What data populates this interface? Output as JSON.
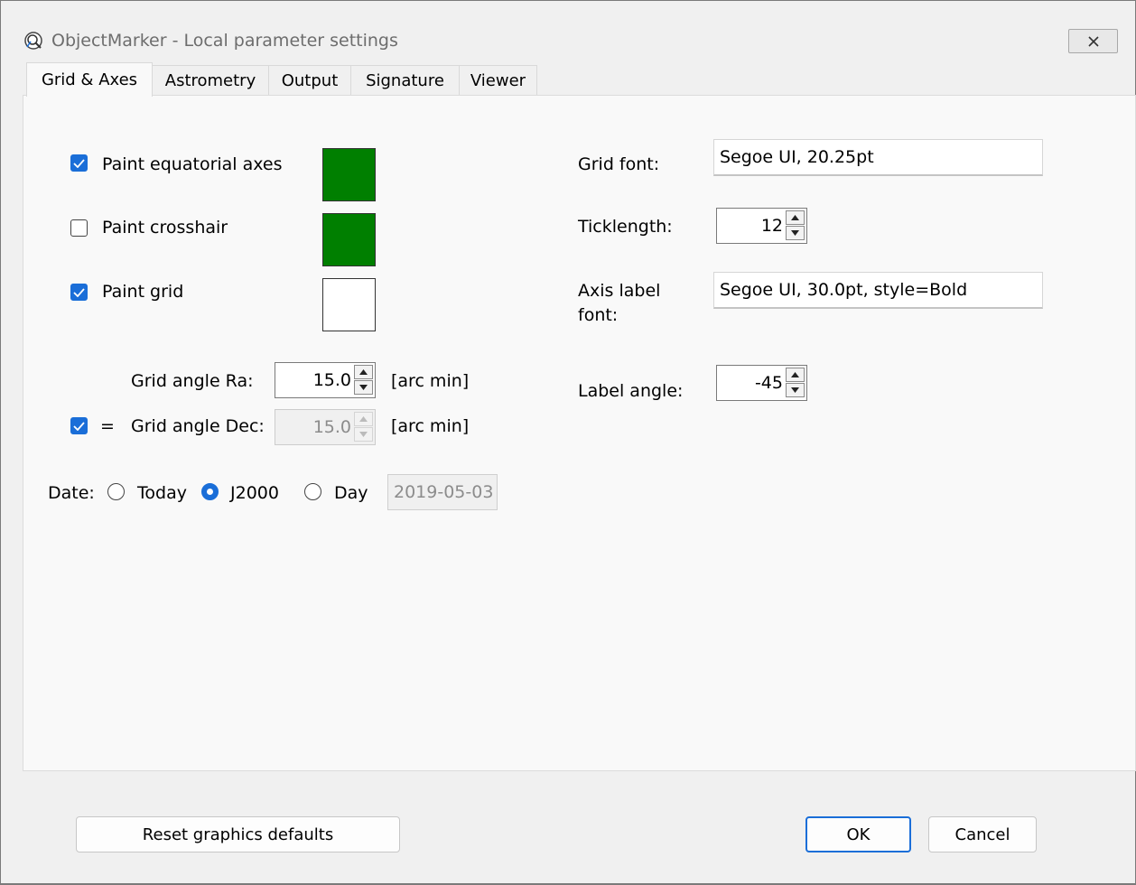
{
  "window": {
    "title": "ObjectMarker - Local parameter settings",
    "icon": "objectmarker-app-icon",
    "close_icon": "close-icon"
  },
  "tabs": [
    {
      "label": "Grid & Axes",
      "active": true
    },
    {
      "label": "Astrometry",
      "active": false
    },
    {
      "label": "Output",
      "active": false
    },
    {
      "label": "Signature",
      "active": false
    },
    {
      "label": "Viewer",
      "active": false
    }
  ],
  "left": {
    "paint_equatorial_axes": {
      "label": "Paint equatorial axes",
      "checked": true,
      "color": "#007f00"
    },
    "paint_crosshair": {
      "label": "Paint crosshair",
      "checked": false,
      "color": "#007f00"
    },
    "paint_grid": {
      "label": "Paint grid",
      "checked": true,
      "color": "#ffffff"
    },
    "grid_angle_ra": {
      "label": "Grid angle Ra:",
      "value": "15.0",
      "unit": "[arc min]"
    },
    "grid_angle_dec": {
      "equal_checked": true,
      "equal_sign": "=",
      "label": "Grid angle Dec:",
      "value": "15.0",
      "unit": "[arc min]",
      "disabled": true
    },
    "date": {
      "label": "Date:",
      "options": [
        {
          "label": "Today",
          "selected": false
        },
        {
          "label": "J2000",
          "selected": true
        },
        {
          "label": "Day",
          "selected": false
        }
      ],
      "day_value": "2019-05-03"
    }
  },
  "right": {
    "grid_font": {
      "label": "Grid font:",
      "value": "Segoe UI, 20.25pt"
    },
    "ticklength": {
      "label": "Ticklength:",
      "value": "12"
    },
    "axis_label_font": {
      "label_line1": "Axis label",
      "label_line2": "font:",
      "value": "Segoe UI, 30.0pt, style=Bold"
    },
    "label_angle": {
      "label": "Label angle:",
      "value": "-45"
    }
  },
  "footer": {
    "reset_label": "Reset graphics defaults",
    "ok_label": "OK",
    "cancel_label": "Cancel"
  },
  "colors": {
    "accent": "#1a6ed8",
    "swatch_green": "#007f00"
  }
}
